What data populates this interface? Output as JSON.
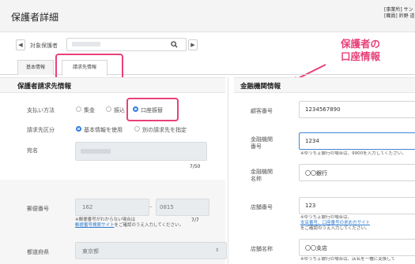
{
  "header": {
    "title": "保護者詳細",
    "office_line": "[事業所] サン",
    "staff_line": "[職員] 鈴野 道"
  },
  "search": {
    "label": "対象保護者",
    "value": "",
    "prev": "◀",
    "next": "▶",
    "search_icon": "search-icon"
  },
  "tabs": [
    {
      "label": "基本情報"
    },
    {
      "label": "請求先情報"
    }
  ],
  "callout": {
    "line1": "保護者の",
    "line2": "口座情報"
  },
  "billing": {
    "section_title": "保護者請求先情報",
    "payment_method": {
      "label": "支払い方法",
      "options": [
        "集金",
        "振込",
        "口座振替"
      ],
      "selected": "口座振替"
    },
    "billing_type": {
      "label": "請求先区分",
      "options": [
        "基本情報を使用",
        "別の請求先を指定"
      ],
      "selected": "基本情報を使用"
    },
    "name": {
      "label": "宛名",
      "value": "",
      "counter": "7/50"
    },
    "postal": {
      "label": "郵便番号",
      "part1": "162",
      "sep": "–",
      "part2": "0815",
      "counter": "7/7",
      "note1": "※郵便番号がわからない場合は",
      "note_link": "郵便番号検索サイト",
      "note2": "をご確認のうえ入力してください。"
    },
    "prefecture": {
      "label": "都道府県",
      "value": "東京都"
    }
  },
  "bank": {
    "section_title": "金融機関情報",
    "customer_no": {
      "label": "顧客番号",
      "value": "1234567890"
    },
    "bank_no": {
      "label_line1": "金融機関",
      "label_line2": "番号",
      "value": "1234",
      "note": "※ゆうちょ銀行の場合は、9900を入力してください。"
    },
    "bank_name": {
      "label_line1": "金融機関",
      "label_line2": "名称",
      "value": "〇〇銀行"
    },
    "branch_no": {
      "label": "店舗番号",
      "value": "123",
      "note1": "※ゆうちょ銀行の場合は、",
      "note_link": "支店番号、口座番号の求め方サイト",
      "note2": "をご確認のうえ入力してください。"
    },
    "branch_name": {
      "label": "店舗名称",
      "value": "〇〇支店",
      "note": "※ゆうちょ銀行の場合は、店名を一種に変換して"
    }
  },
  "colors": {
    "accent": "#2f7fe0",
    "highlight": "#e8407a"
  }
}
